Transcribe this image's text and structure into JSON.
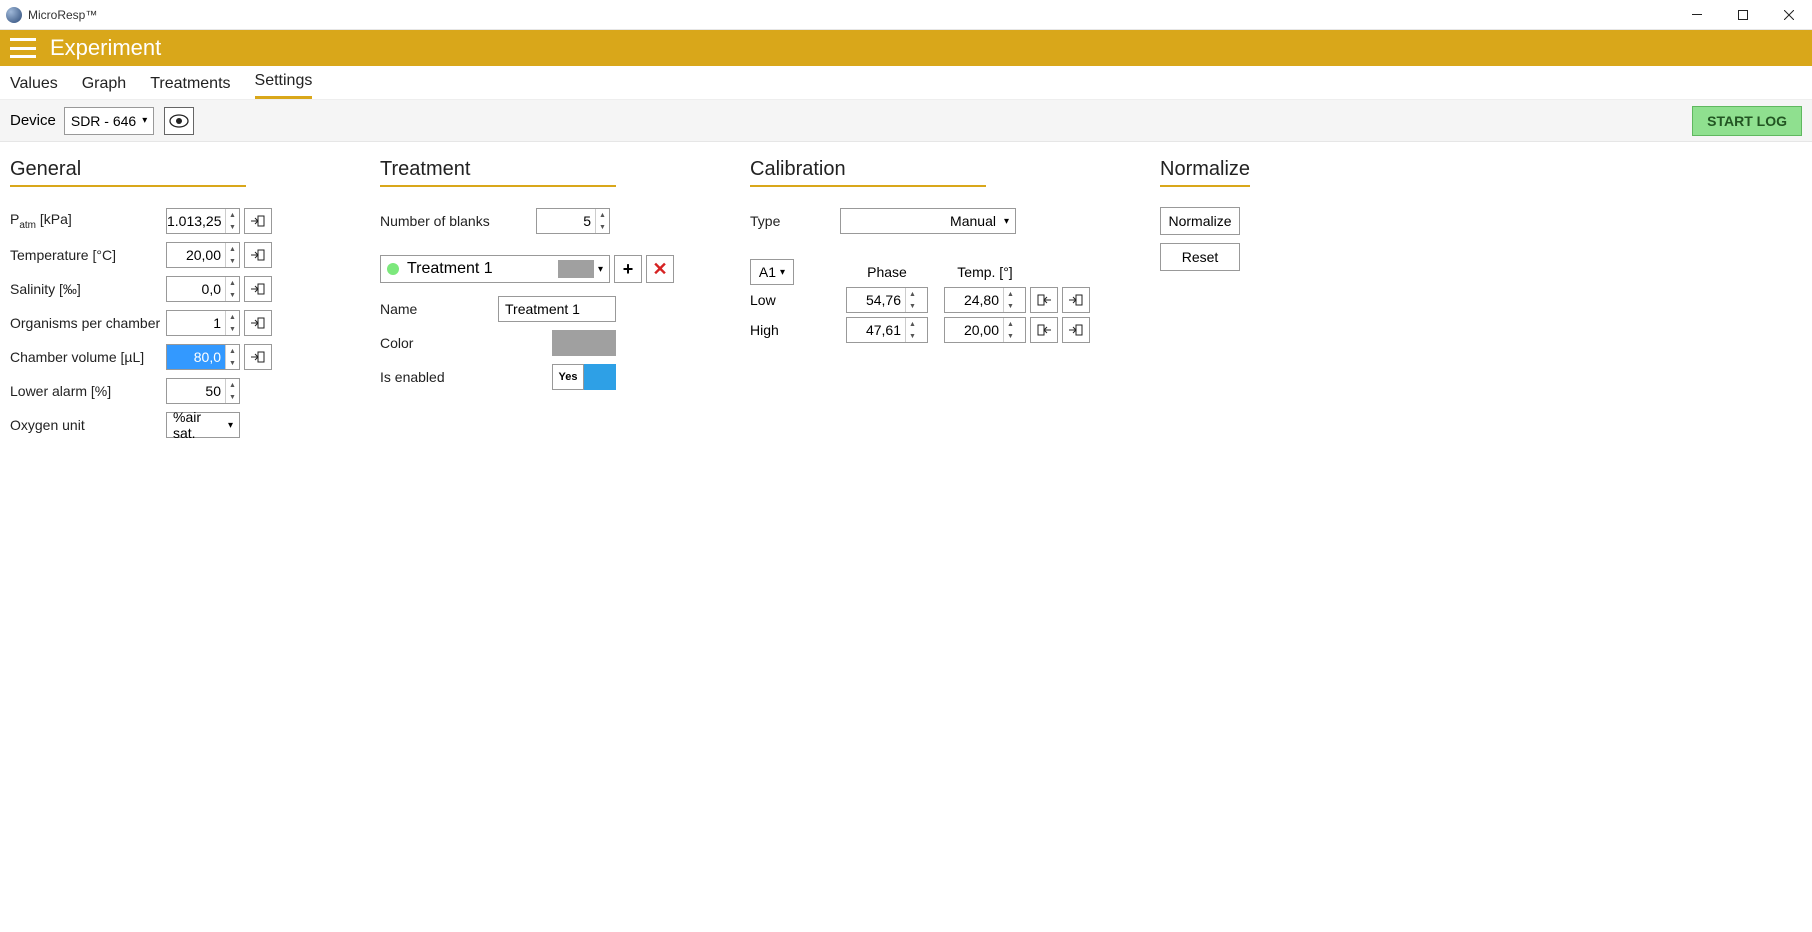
{
  "window": {
    "title": "MicroResp™"
  },
  "header": {
    "page_title": "Experiment"
  },
  "tabs": {
    "values": "Values",
    "graph": "Graph",
    "treatments": "Treatments",
    "settings": "Settings",
    "active": "settings"
  },
  "toolbar": {
    "device_label": "Device",
    "device_value": "SDR - 646",
    "start_log": "START LOG"
  },
  "general": {
    "heading": "General",
    "fields": {
      "patm": {
        "label": "Pₐₜₘ [kPa]",
        "value": "1.013,25"
      },
      "temp": {
        "label": "Temperature [°C]",
        "value": "20,00"
      },
      "sal": {
        "label": "Salinity [‰]",
        "value": "0,0"
      },
      "org": {
        "label": "Organisms per chamber",
        "value": "1"
      },
      "vol": {
        "label": "Chamber volume [µL]",
        "value": "80,0",
        "selected": true
      },
      "alarm": {
        "label": "Lower alarm [%]",
        "value": "50"
      },
      "oxy": {
        "label": "Oxygen unit",
        "value": "%air sat."
      }
    }
  },
  "treatment": {
    "heading": "Treatment",
    "blanks_label": "Number of blanks",
    "blanks_value": "5",
    "selected": "Treatment 1",
    "fields": {
      "name": {
        "label": "Name",
        "value": "Treatment 1"
      },
      "color": {
        "label": "Color",
        "value": "#a0a0a0"
      },
      "enabled": {
        "label": "Is enabled",
        "value": "Yes"
      }
    }
  },
  "calibration": {
    "heading": "Calibration",
    "type_label": "Type",
    "type_value": "Manual",
    "well": "A1",
    "headers": {
      "phase": "Phase",
      "temp": "Temp. [°]"
    },
    "rows": {
      "low": {
        "label": "Low",
        "phase": "54,76",
        "temp": "24,80"
      },
      "high": {
        "label": "High",
        "phase": "47,61",
        "temp": "20,00"
      }
    }
  },
  "normalize": {
    "heading": "Normalize",
    "normalize_btn": "Normalize",
    "reset_btn": "Reset"
  },
  "colors": {
    "accent": "#d9a71a",
    "start_log_bg": "#8fe08f",
    "toggle_on": "#2ea0e6",
    "dot": "#7ce87c"
  }
}
